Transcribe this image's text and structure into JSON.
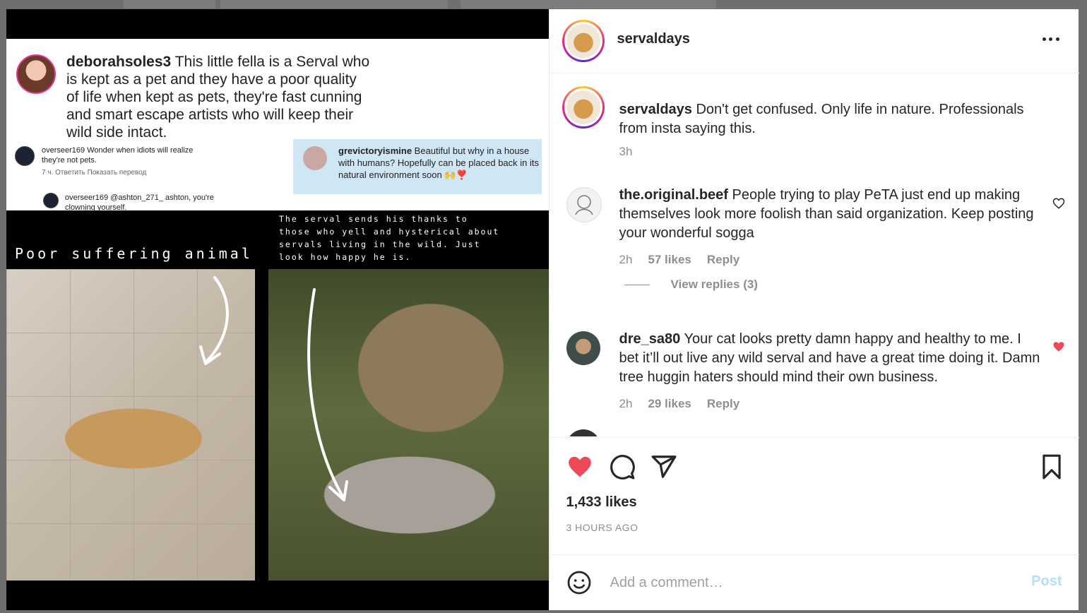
{
  "media": {
    "top_comment": {
      "username": "deborahsoles3",
      "text": "This little fella is a Serval who is kept as a pet and they have a poor quality of life when kept as pets, they're fast cunning and smart escape artists who will keep their wild side intact."
    },
    "small_comment_1": {
      "username": "overseer169",
      "text": "Wonder when idiots will realize they're not pets.",
      "meta": "7 ч.   Ответить   Показать перевод"
    },
    "small_comment_2": {
      "username": "overseer169",
      "text": "@ashton_271_ ashton, you're clowning yourself."
    },
    "blue_comment": {
      "username": "grevictoryismine",
      "text": "Beautiful but why in a house with humans? Hopefully can be placed back in its natural environment soon 🙌❣️"
    },
    "caption_left": "Poor suffering animal",
    "caption_right": "The serval sends his thanks to those who yell and hysterical about servals living in the wild. Just look how happy he is."
  },
  "post": {
    "author": "servaldays",
    "caption": {
      "username": "servaldays",
      "text": "Don't get confused. Only life in nature. Professionals from insta saying this.",
      "time": "3h"
    },
    "comments": [
      {
        "username": "the.original.beef",
        "text": "People trying to play PeTA just end up making themselves look more foolish than said organization. Keep posting your wonderful sogga",
        "time": "2h",
        "likes": "57 likes",
        "reply": "Reply",
        "liked": false
      },
      {
        "username": "dre_sa80",
        "text": "Your cat looks pretty damn happy and healthy to me. I bet it’ll out live any wild serval and have a great time doing it. Damn tree huggin haters should mind their own business.",
        "time": "2h",
        "likes": "29 likes",
        "reply": "Reply",
        "liked": true
      }
    ],
    "view_replies": "View replies (3)",
    "likes": "1,433 likes",
    "time_ago": "3 HOURS AGO",
    "add_comment_placeholder": "Add a comment…",
    "post_button": "Post"
  },
  "colors": {
    "liked_red": "#ed4956",
    "post_blue": "#b2dffc",
    "muted": "#8e8e8e"
  }
}
